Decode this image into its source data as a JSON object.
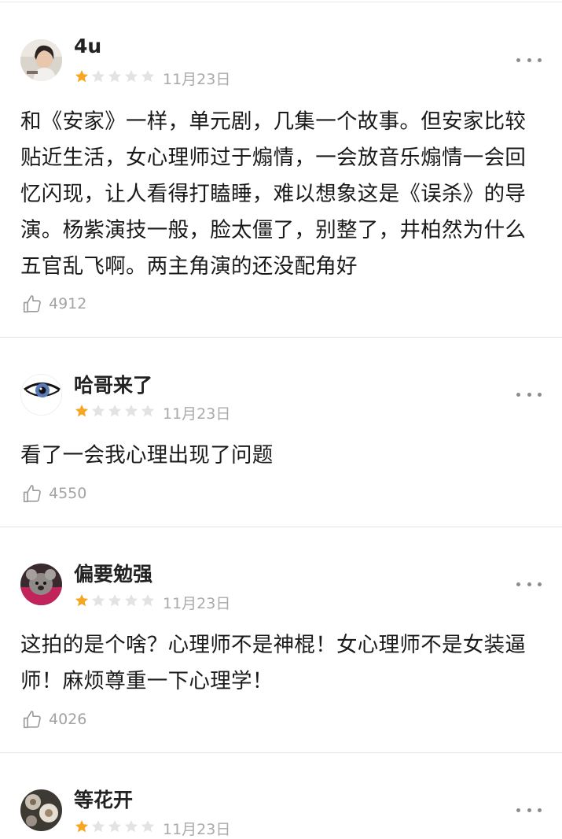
{
  "comments": [
    {
      "user": "4u",
      "rating": 1,
      "max_rating": 5,
      "date": "11月23日",
      "content": "和《安家》一样，单元剧，几集一个故事。但安家比较贴近生活，女心理师过于煽情，一会放音乐煽情一会回忆闪现，让人看得打瞌睡，难以想象这是《误杀》的导演。杨紫演技一般，脸太僵了，别整了，井柏然为什么五官乱飞啊。两主角演的还没配角好",
      "likes": "4912",
      "avatar_icon": "user-photo-avatar"
    },
    {
      "user": "哈哥来了",
      "rating": 1,
      "max_rating": 5,
      "date": "11月23日",
      "content": "看了一会我心理出现了问题",
      "likes": "4550",
      "avatar_icon": "eye-drawing-avatar"
    },
    {
      "user": "偏要勉强",
      "rating": 1,
      "max_rating": 5,
      "date": "11月23日",
      "content": "这拍的是个啥？心理师不是神棍！女心理师不是女装逼师！麻烦尊重一下心理学！",
      "likes": "4026",
      "avatar_icon": "animal-photo-avatar"
    },
    {
      "user": "等花开",
      "rating": 1,
      "max_rating": 5,
      "date": "11月23日",
      "avatar_icon": "flower-photo-avatar"
    }
  ],
  "colors": {
    "star_filled": "#f5a623",
    "star_empty": "#e3e3e3",
    "text": "#1a1a1a",
    "muted": "#aaaaaa"
  },
  "icons": {
    "like": "thumbs-up-icon",
    "more": "more-options-icon",
    "star": "star-icon"
  }
}
